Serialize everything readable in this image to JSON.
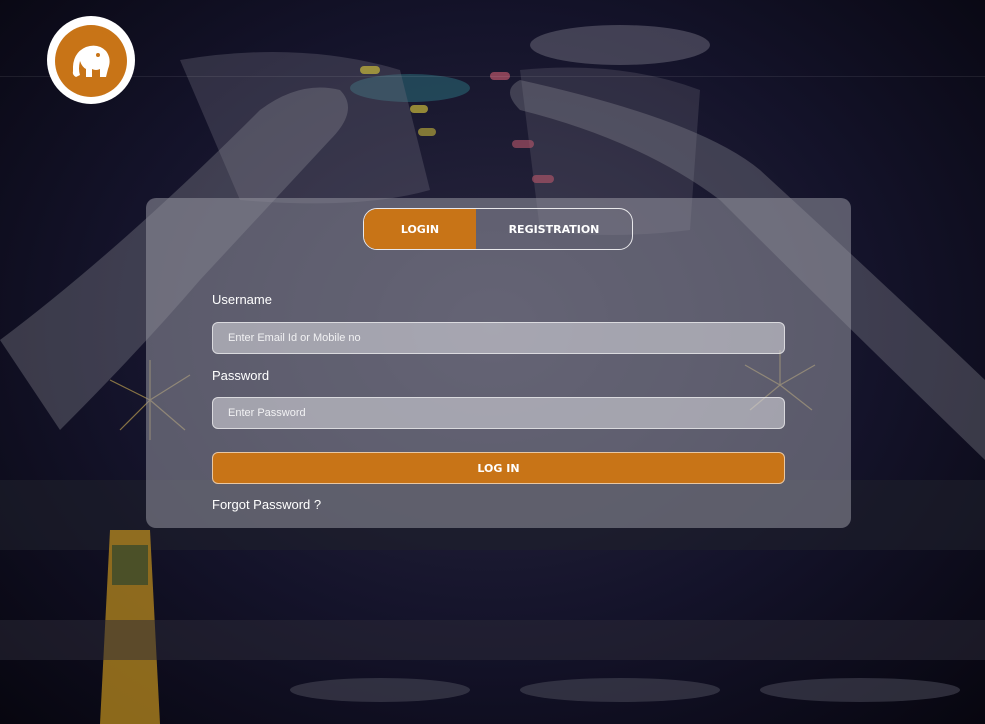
{
  "logo": {
    "icon": "elephant-emblem-icon",
    "color": "#c87417"
  },
  "tabs": [
    {
      "label": "LOGIN",
      "active": true
    },
    {
      "label": "REGISTRATION",
      "active": false
    }
  ],
  "form": {
    "username_label": "Username",
    "username_placeholder": "Enter Email Id or Mobile no",
    "password_label": "Password",
    "password_placeholder": "Enter Password",
    "login_button": "LOG IN",
    "forgot_password": "Forgot Password ?"
  },
  "colors": {
    "accent": "#c87417"
  }
}
